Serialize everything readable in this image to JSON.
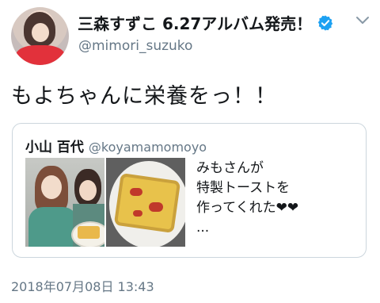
{
  "author": {
    "display_name": "三森すずこ 6.27アルバム発売！",
    "handle": "@mimori_suzuko"
  },
  "tweet": {
    "text": "もよちゃんに栄養をっ！！"
  },
  "quoted_tweet": {
    "name": "小山 百代",
    "handle": "@koyamamomoyo",
    "text_lines": [
      "みもさんが",
      "特製トーストを",
      "作ってくれた❤❤",
      "..."
    ]
  },
  "timestamp": "2018年07月08日 13:43",
  "icons": {
    "verified": "verified-badge-icon",
    "menu": "chevron-down-icon"
  },
  "colors": {
    "verified_blue": "#1da1f2",
    "secondary_text": "#657786",
    "border": "#ccd6dd"
  }
}
